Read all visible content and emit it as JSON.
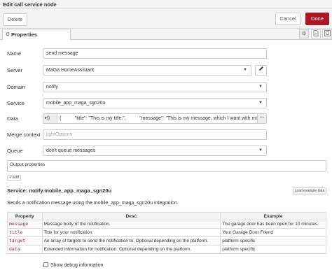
{
  "window": {
    "title": "Edit call service node"
  },
  "actions": {
    "delete_label": "Delete",
    "cancel_label": "Cancel",
    "done_label": "Done"
  },
  "tabs": {
    "properties_label": "Properties"
  },
  "icons": {
    "properties_tab": "gear-icon",
    "settings": "gear-icon",
    "description": "document-icon",
    "appearance": "layout-icon",
    "edit_server": "pencil-icon",
    "data_more": "ellipsis-icon"
  },
  "form": {
    "name": {
      "label": "Name",
      "value": "send message"
    },
    "server": {
      "label": "Server",
      "value": "MaGa HomeAssistant"
    },
    "domain": {
      "label": "Domain",
      "value": "notify"
    },
    "service": {
      "label": "Service",
      "value": "mobile_app_maga_sgn20u"
    },
    "data": {
      "label": "Data",
      "type_label": "{}",
      "value": "{          \"title\": \"This is my title.\",          \"message\": \"This is my message, which I want with mu"
    },
    "merge_context": {
      "label": "Merge context",
      "placeholder": "lightOptions"
    },
    "queue": {
      "label": "Queue",
      "value": "don't queue messages"
    }
  },
  "output_properties": {
    "label": "Output properties",
    "add_label": "+ add"
  },
  "service_info": {
    "title": "Service: notify.mobile_app_maga_sgn20u",
    "load_example_label": "Load example data",
    "description": "Sends a notification message using the mobile_app_maga_sgn20u integration.",
    "table": {
      "headers": [
        "Property",
        "Desc",
        "Example"
      ],
      "rows": [
        [
          "message",
          "Message body of the notification.",
          "The garage door has been open for 10 minutes."
        ],
        [
          "title",
          "Title for your notification.",
          "Your Garage Door Friend"
        ],
        [
          "target",
          "An array of targets to send the notification to. Optional depending on the platform.",
          "platform specific"
        ],
        [
          "data",
          "Extended information for notification. Optional depending on the platform.",
          "platform specific"
        ]
      ]
    }
  },
  "debug": {
    "label": "Show debug information",
    "checked": false
  }
}
